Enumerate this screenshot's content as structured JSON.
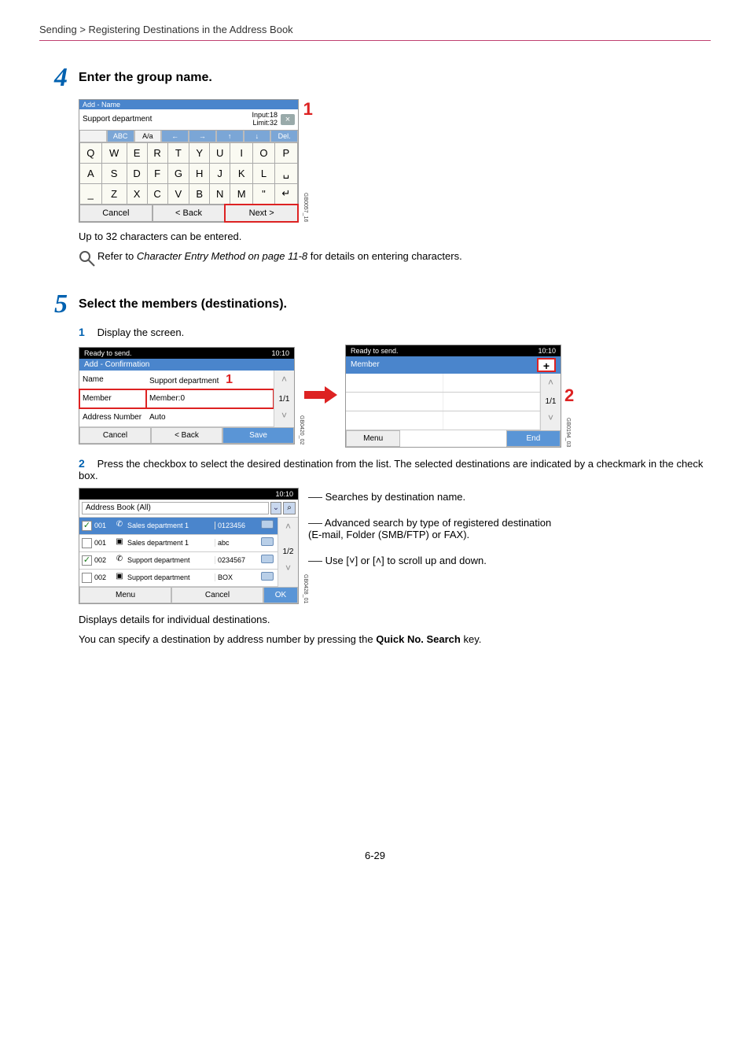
{
  "breadcrumb": "Sending > Registering Destinations in the Address Book",
  "step4": {
    "num": "4",
    "title": "Enter the group name.",
    "keyboard": {
      "header": "Add - Name",
      "entry": "Support department",
      "input": "Input:18",
      "limit": "Limit:32",
      "modes": {
        "blank": "",
        "abc_u": "ABC",
        "aa": "A/a",
        "back": "←",
        "fwd": "→",
        "up": "↑",
        "down": "↓",
        "del": "Del."
      },
      "row1": [
        "Q",
        "W",
        "E",
        "R",
        "T",
        "Y",
        "U",
        "I",
        "O",
        "P"
      ],
      "row2": [
        "A",
        "S",
        "D",
        "F",
        "G",
        "H",
        "J",
        "K",
        "L",
        "␣"
      ],
      "row3": [
        "_",
        "Z",
        "X",
        "C",
        "V",
        "B",
        "N",
        "M",
        "\"",
        "↵"
      ],
      "cancel": "Cancel",
      "backbtn": "< Back",
      "next": "Next >",
      "gb": "GB0057_16"
    },
    "callout": "1",
    "note1": "Up to 32 characters can be entered.",
    "note2_a": "Refer to ",
    "note2_i": "Character Entry Method on page 11-8",
    "note2_b": " for details on entering characters."
  },
  "step5": {
    "num": "5",
    "title": "Select the members (destinations).",
    "sub1_num": "1",
    "sub1_text": "Display the screen.",
    "conf": {
      "hdr1": "Ready to send.",
      "time": "10:10",
      "hdr2": "Add - Confirmation",
      "rows": [
        {
          "l": "Name",
          "v": "Support department",
          "callout": "1"
        },
        {
          "l": "Member",
          "v": "Member:0",
          "hl": true
        },
        {
          "l": "Address Number",
          "v": "Auto"
        }
      ],
      "page": "1/1",
      "cancel": "Cancel",
      "back": "< Back",
      "save": "Save",
      "gb": "GB0420_02"
    },
    "mem": {
      "hdr1": "Ready to send.",
      "time": "10:10",
      "hdr2": "Member",
      "plus": "+",
      "callout": "2",
      "page": "1/1",
      "menu": "Menu",
      "end": "End",
      "gb": "GB0194_03"
    },
    "sub2_num": "2",
    "sub2_text": "Press the checkbox to select the desired destination from the list. The selected destinations are indicated by a checkmark in the check box.",
    "ab": {
      "time": "10:10",
      "filter": "Address Book (All)",
      "rows": [
        {
          "chk": true,
          "num": "001",
          "name": "Sales department 1",
          "col2": "0123456",
          "sel": true
        },
        {
          "chk": false,
          "num": "001",
          "name": "Sales department 1",
          "col2": "abc"
        },
        {
          "chk": true,
          "num": "002",
          "name": "Support department",
          "col2": "0234567"
        },
        {
          "chk": false,
          "num": "002",
          "name": "Support department",
          "col2": "BOX"
        }
      ],
      "page": "1/2",
      "menu": "Menu",
      "cancel": "Cancel",
      "ok": "OK",
      "gb": "GB0428_01"
    },
    "ab_notes": {
      "n1": "Searches by destination name.",
      "n2": "Advanced search by type of registered destination (E-mail, Folder (SMB/FTP) or FAX).",
      "n3a": "Use [",
      "n3b": "] or [",
      "n3c": "] to scroll up and down."
    },
    "tail1": "Displays details for individual destinations.",
    "tail2a": "You can specify a destination by address number by pressing the ",
    "tail2b": "Quick No. Search",
    "tail2c": " key."
  },
  "page_num": "6-29"
}
